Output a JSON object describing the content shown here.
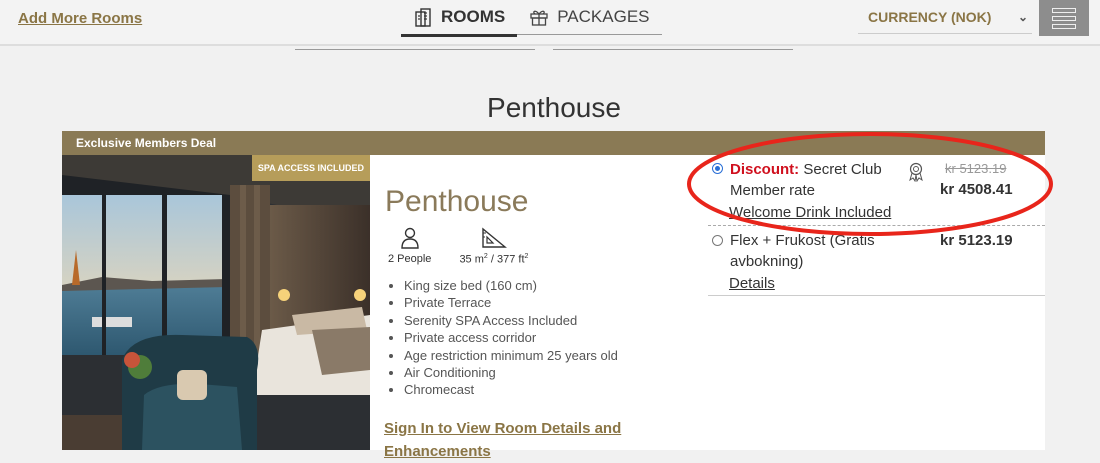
{
  "header": {
    "add_rooms_label": "Add More Rooms",
    "tabs": [
      {
        "label": "ROOMS",
        "icon": "building-icon",
        "active": true
      },
      {
        "label": "PACKAGES",
        "icon": "gift-icon",
        "active": false
      }
    ],
    "currency_label": "CURRENCY (NOK)",
    "menu_icon": "hamburger-menu-icon"
  },
  "page_title": "Penthouse",
  "deal_banner": "Exclusive Members Deal",
  "room": {
    "badge": "SPA ACCESS INCLUDED",
    "name": "Penthouse",
    "occupancy": "2 People",
    "size_m2": "35 m",
    "size_sup_m": "2",
    "size_ft2": " / 377 ft",
    "size_sup_ft": "2",
    "features": [
      "King size bed (160 cm)",
      "Private Terrace",
      "Serenity SPA Access Included",
      "Private access corridor",
      "Age restriction minimum 25 years old",
      "Air Conditioning",
      "Chromecast"
    ],
    "signin_link": "Sign In to View Room Details and Enhancements"
  },
  "rates": [
    {
      "prefix": "Discount:",
      "name": "Secret Club Member rate",
      "link": "Welcome Drink Included",
      "old_price": "kr 5123.19",
      "price": "kr 4508.41",
      "selected": true,
      "icon": "award-ribbon-icon"
    },
    {
      "prefix": "",
      "name": "Flex + Frukost (Gratis avbokning)",
      "link": "Details",
      "old_price": "",
      "price": "kr 5123.19",
      "selected": false
    }
  ],
  "colors": {
    "brand_gold": "#8a7545",
    "deal_bar": "#8a7a55",
    "badge": "#b69d5a",
    "discount_red": "#d0101e",
    "highlight_red": "#e8251b"
  }
}
